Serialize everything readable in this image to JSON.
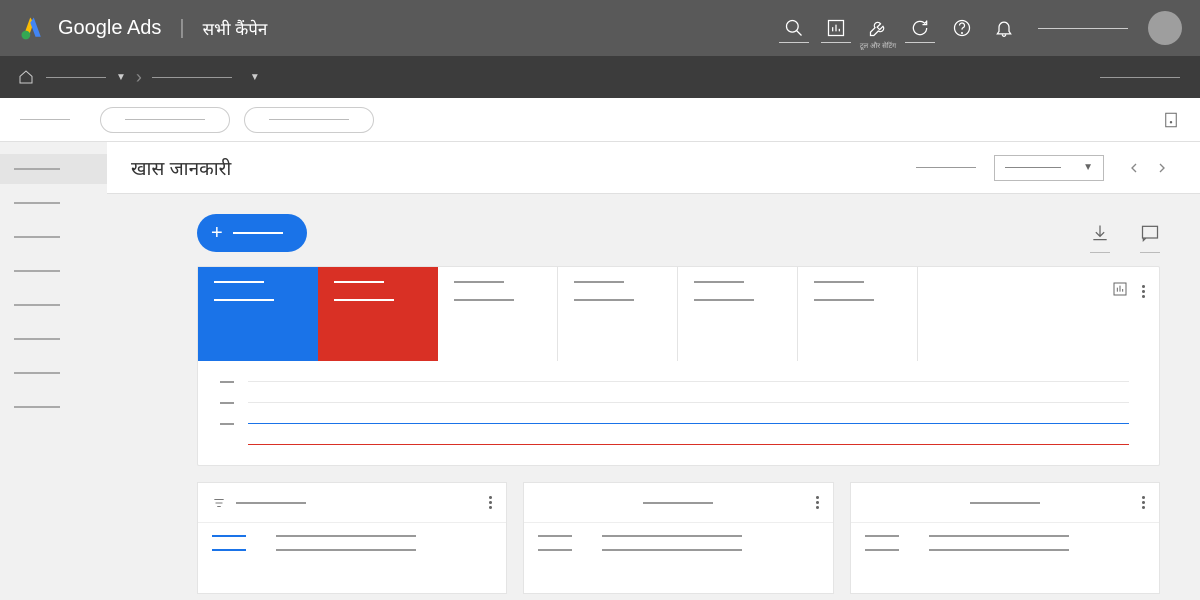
{
  "header": {
    "brand": "Google Ads",
    "subtitle": "सभी कैंपेन",
    "tools_label": "टूल और सेटिंग"
  },
  "titlebar": {
    "title": "खास जानकारी"
  },
  "sidebar": {
    "items": [
      {
        "active": true
      },
      {},
      {},
      {},
      {},
      {},
      {},
      {}
    ]
  }
}
